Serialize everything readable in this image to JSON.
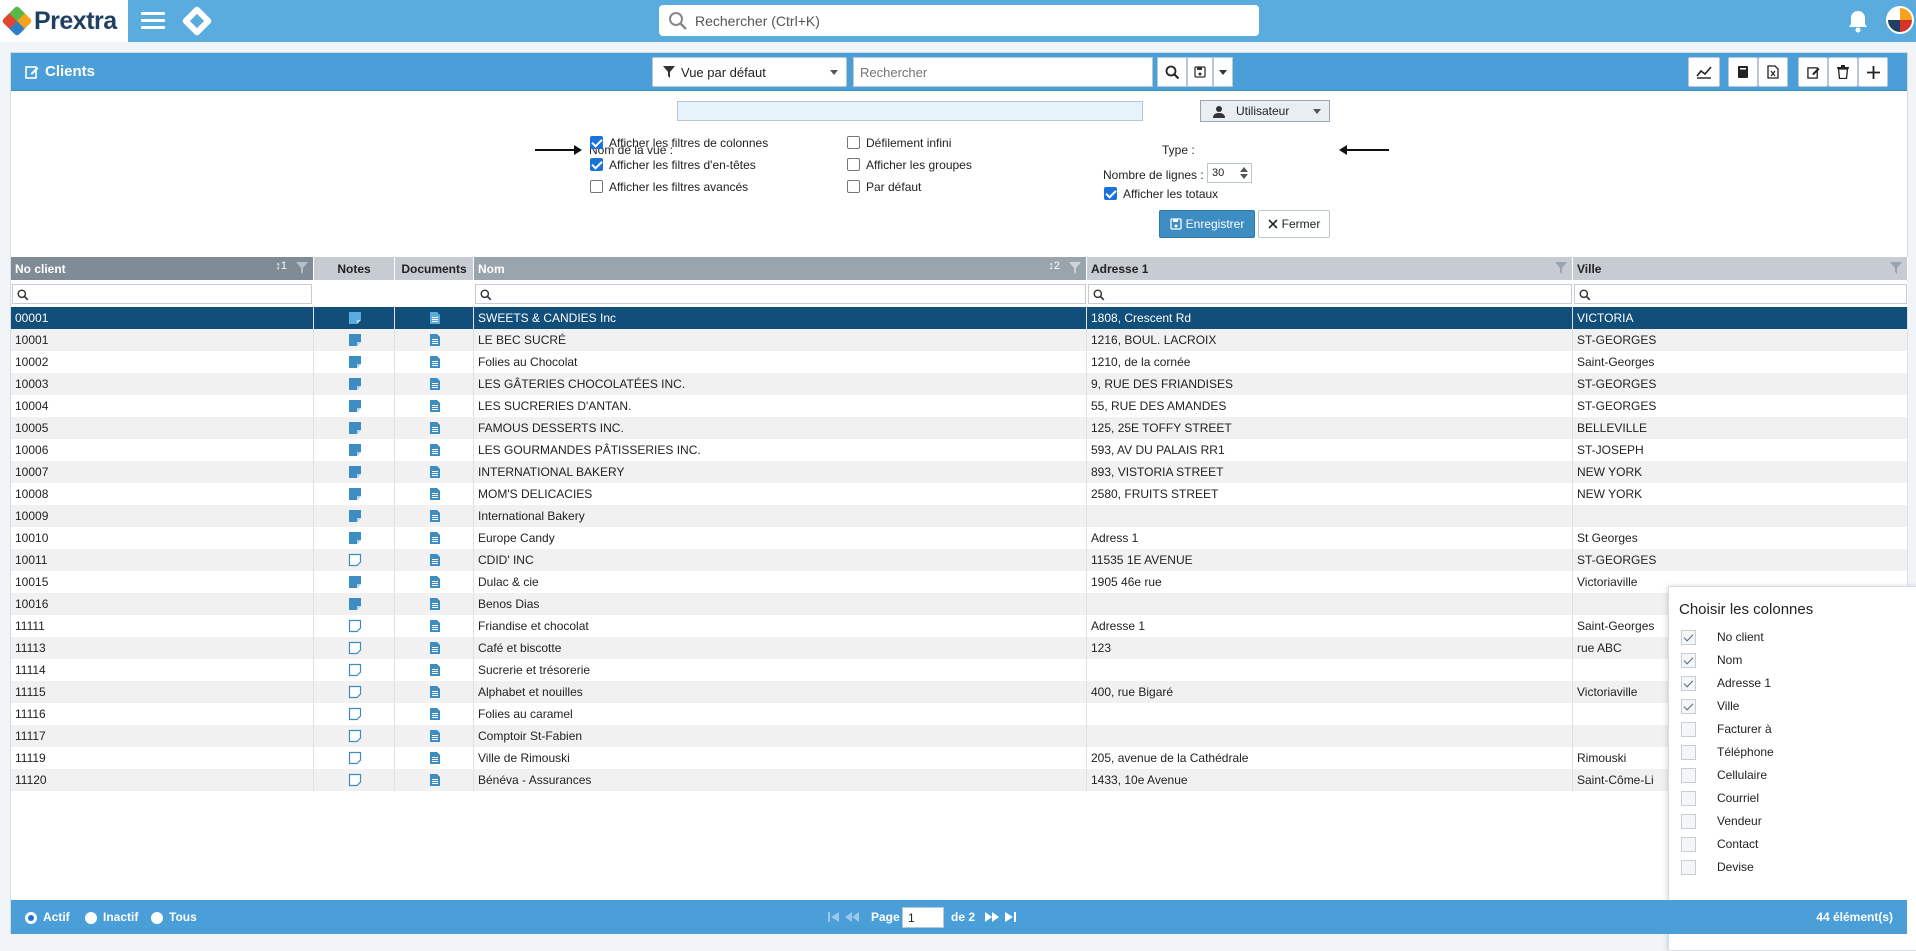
{
  "app": {
    "logo_text": "Prextra",
    "global_search_placeholder": "Rechercher (Ctrl+K)"
  },
  "panel": {
    "title": "Clients",
    "view_select": "Vue par défaut",
    "view_search_placeholder": "Rechercher"
  },
  "settings": {
    "view_name_label": "Nom de la vue :",
    "view_name_value": "",
    "type_label": "Type :",
    "type_value": "Utilisateur",
    "options_col1": [
      {
        "label": "Afficher les filtres de colonnes",
        "checked": true
      },
      {
        "label": "Afficher les filtres d'en-têtes",
        "checked": true
      },
      {
        "label": "Afficher les filtres avancés",
        "checked": false
      }
    ],
    "options_col2": [
      {
        "label": "Défilement infini",
        "checked": false
      },
      {
        "label": "Afficher les groupes",
        "checked": false
      },
      {
        "label": "Par défaut",
        "checked": false
      }
    ],
    "rows_label": "Nombre de lignes :",
    "rows_value": "30",
    "totals_label": "Afficher les totaux",
    "totals_checked": true,
    "save_label": "Enregistrer",
    "close_label": "Fermer"
  },
  "grid": {
    "columns": [
      {
        "label": "No client",
        "sort": "1"
      },
      {
        "label": "Notes"
      },
      {
        "label": "Documents"
      },
      {
        "label": "Nom",
        "sort": "2"
      },
      {
        "label": "Adresse 1"
      },
      {
        "label": "Ville"
      }
    ],
    "rows": [
      {
        "no": "00001",
        "note": "filled",
        "nom": "SWEETS & CANDIES Inc",
        "adresse": "1808, Crescent Rd",
        "ville": "VICTORIA"
      },
      {
        "no": "10001",
        "note": "filled",
        "nom": "LE BEC SUCRÉ",
        "adresse": "1216, BOUL. LACROIX",
        "ville": "ST-GEORGES"
      },
      {
        "no": "10002",
        "note": "filled",
        "nom": "Folies au Chocolat",
        "adresse": "1210, de la cornée",
        "ville": "Saint-Georges"
      },
      {
        "no": "10003",
        "note": "filled",
        "nom": "LES GÂTERIES CHOCOLATÉES INC.",
        "adresse": "9, RUE DES FRIANDISES",
        "ville": "ST-GEORGES"
      },
      {
        "no": "10004",
        "note": "filled",
        "nom": "LES SUCRERIES D'ANTAN.",
        "adresse": "55, RUE DES AMANDES",
        "ville": "ST-GEORGES"
      },
      {
        "no": "10005",
        "note": "filled",
        "nom": "FAMOUS DESSERTS INC.",
        "adresse": "125, 25E TOFFY STREET",
        "ville": "BELLEVILLE"
      },
      {
        "no": "10006",
        "note": "filled",
        "nom": "LES GOURMANDES PÂTISSERIES INC.",
        "adresse": "593, AV DU PALAIS RR1",
        "ville": "ST-JOSEPH"
      },
      {
        "no": "10007",
        "note": "filled",
        "nom": "INTERNATIONAL BAKERY",
        "adresse": "893, VISTORIA STREET",
        "ville": "NEW YORK"
      },
      {
        "no": "10008",
        "note": "filled",
        "nom": "MOM'S DELICACIES",
        "adresse": "2580, FRUITS STREET",
        "ville": "NEW YORK"
      },
      {
        "no": "10009",
        "note": "filled",
        "nom": "International Bakery",
        "adresse": "",
        "ville": ""
      },
      {
        "no": "10010",
        "note": "filled",
        "nom": "Europe Candy",
        "adresse": "Adress 1",
        "ville": "St Georges"
      },
      {
        "no": "10011",
        "note": "empty",
        "nom": "CDID' INC",
        "adresse": "11535 1E AVENUE",
        "ville": "ST-GEORGES"
      },
      {
        "no": "10015",
        "note": "filled",
        "nom": "Dulac & cie",
        "adresse": "1905 46e rue",
        "ville": "Victoriaville"
      },
      {
        "no": "10016",
        "note": "filled",
        "nom": "Benos Dias",
        "adresse": "",
        "ville": ""
      },
      {
        "no": "11111",
        "note": "empty",
        "nom": "Friandise et chocolat",
        "adresse": "Adresse 1",
        "ville": "Saint-Georges"
      },
      {
        "no": "11113",
        "note": "empty",
        "nom": "Café et biscotte",
        "adresse": "123",
        "ville": "rue ABC"
      },
      {
        "no": "11114",
        "note": "empty",
        "nom": "Sucrerie et trésorerie",
        "adresse": "",
        "ville": ""
      },
      {
        "no": "11115",
        "note": "empty",
        "nom": "Alphabet et nouilles",
        "adresse": "400, rue Bigaré",
        "ville": "Victoriaville"
      },
      {
        "no": "11116",
        "note": "empty",
        "nom": "Folies au caramel",
        "adresse": "",
        "ville": ""
      },
      {
        "no": "11117",
        "note": "empty",
        "nom": "Comptoir St-Fabien",
        "adresse": "",
        "ville": ""
      },
      {
        "no": "11119",
        "note": "empty",
        "nom": "Ville de Rimouski",
        "adresse": "205, avenue de la Cathédrale",
        "ville": "Rimouski"
      },
      {
        "no": "11120",
        "note": "empty",
        "nom": "Bénéva - Assurances",
        "adresse": "1433, 10e Avenue",
        "ville": "Saint-Côme-Li"
      }
    ]
  },
  "column_chooser": {
    "title": "Choisir les colonnes",
    "items": [
      {
        "label": "No client",
        "checked": true
      },
      {
        "label": "Nom",
        "checked": true
      },
      {
        "label": "Adresse 1",
        "checked": true
      },
      {
        "label": "Ville",
        "checked": true
      },
      {
        "label": "Facturer à",
        "checked": false
      },
      {
        "label": "Téléphone",
        "checked": false
      },
      {
        "label": "Cellulaire",
        "checked": false
      },
      {
        "label": "Courriel",
        "checked": false
      },
      {
        "label": "Vendeur",
        "checked": false
      },
      {
        "label": "Contact",
        "checked": false
      },
      {
        "label": "Devise",
        "checked": false
      }
    ]
  },
  "footer": {
    "status_options": [
      "Actif",
      "Inactif",
      "Tous"
    ],
    "status_selected": "Actif",
    "page_label": "Page",
    "page_value": "1",
    "page_of": "de 2",
    "count": "44 élément(s)"
  },
  "colors": {
    "topbar": "#5aacde",
    "panel_header": "#4a9fd8",
    "selected_row": "#114e7a"
  }
}
